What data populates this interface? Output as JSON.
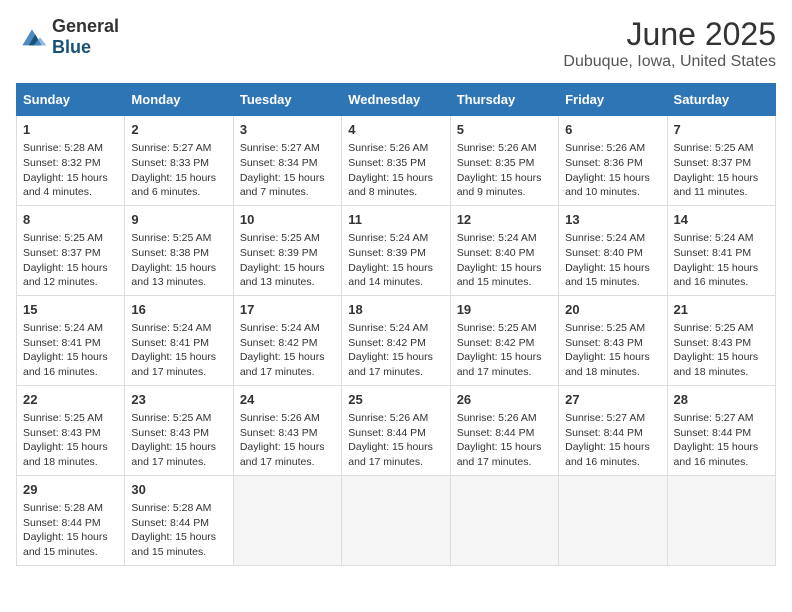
{
  "logo": {
    "general": "General",
    "blue": "Blue"
  },
  "header": {
    "month": "June 2025",
    "location": "Dubuque, Iowa, United States"
  },
  "weekdays": [
    "Sunday",
    "Monday",
    "Tuesday",
    "Wednesday",
    "Thursday",
    "Friday",
    "Saturday"
  ],
  "weeks": [
    [
      {
        "day": "1",
        "sunrise": "5:28 AM",
        "sunset": "8:32 PM",
        "daylight": "15 hours and 4 minutes."
      },
      {
        "day": "2",
        "sunrise": "5:27 AM",
        "sunset": "8:33 PM",
        "daylight": "15 hours and 6 minutes."
      },
      {
        "day": "3",
        "sunrise": "5:27 AM",
        "sunset": "8:34 PM",
        "daylight": "15 hours and 7 minutes."
      },
      {
        "day": "4",
        "sunrise": "5:26 AM",
        "sunset": "8:35 PM",
        "daylight": "15 hours and 8 minutes."
      },
      {
        "day": "5",
        "sunrise": "5:26 AM",
        "sunset": "8:35 PM",
        "daylight": "15 hours and 9 minutes."
      },
      {
        "day": "6",
        "sunrise": "5:26 AM",
        "sunset": "8:36 PM",
        "daylight": "15 hours and 10 minutes."
      },
      {
        "day": "7",
        "sunrise": "5:25 AM",
        "sunset": "8:37 PM",
        "daylight": "15 hours and 11 minutes."
      }
    ],
    [
      {
        "day": "8",
        "sunrise": "5:25 AM",
        "sunset": "8:37 PM",
        "daylight": "15 hours and 12 minutes."
      },
      {
        "day": "9",
        "sunrise": "5:25 AM",
        "sunset": "8:38 PM",
        "daylight": "15 hours and 13 minutes."
      },
      {
        "day": "10",
        "sunrise": "5:25 AM",
        "sunset": "8:39 PM",
        "daylight": "15 hours and 13 minutes."
      },
      {
        "day": "11",
        "sunrise": "5:24 AM",
        "sunset": "8:39 PM",
        "daylight": "15 hours and 14 minutes."
      },
      {
        "day": "12",
        "sunrise": "5:24 AM",
        "sunset": "8:40 PM",
        "daylight": "15 hours and 15 minutes."
      },
      {
        "day": "13",
        "sunrise": "5:24 AM",
        "sunset": "8:40 PM",
        "daylight": "15 hours and 15 minutes."
      },
      {
        "day": "14",
        "sunrise": "5:24 AM",
        "sunset": "8:41 PM",
        "daylight": "15 hours and 16 minutes."
      }
    ],
    [
      {
        "day": "15",
        "sunrise": "5:24 AM",
        "sunset": "8:41 PM",
        "daylight": "15 hours and 16 minutes."
      },
      {
        "day": "16",
        "sunrise": "5:24 AM",
        "sunset": "8:41 PM",
        "daylight": "15 hours and 17 minutes."
      },
      {
        "day": "17",
        "sunrise": "5:24 AM",
        "sunset": "8:42 PM",
        "daylight": "15 hours and 17 minutes."
      },
      {
        "day": "18",
        "sunrise": "5:24 AM",
        "sunset": "8:42 PM",
        "daylight": "15 hours and 17 minutes."
      },
      {
        "day": "19",
        "sunrise": "5:25 AM",
        "sunset": "8:42 PM",
        "daylight": "15 hours and 17 minutes."
      },
      {
        "day": "20",
        "sunrise": "5:25 AM",
        "sunset": "8:43 PM",
        "daylight": "15 hours and 18 minutes."
      },
      {
        "day": "21",
        "sunrise": "5:25 AM",
        "sunset": "8:43 PM",
        "daylight": "15 hours and 18 minutes."
      }
    ],
    [
      {
        "day": "22",
        "sunrise": "5:25 AM",
        "sunset": "8:43 PM",
        "daylight": "15 hours and 18 minutes."
      },
      {
        "day": "23",
        "sunrise": "5:25 AM",
        "sunset": "8:43 PM",
        "daylight": "15 hours and 17 minutes."
      },
      {
        "day": "24",
        "sunrise": "5:26 AM",
        "sunset": "8:43 PM",
        "daylight": "15 hours and 17 minutes."
      },
      {
        "day": "25",
        "sunrise": "5:26 AM",
        "sunset": "8:44 PM",
        "daylight": "15 hours and 17 minutes."
      },
      {
        "day": "26",
        "sunrise": "5:26 AM",
        "sunset": "8:44 PM",
        "daylight": "15 hours and 17 minutes."
      },
      {
        "day": "27",
        "sunrise": "5:27 AM",
        "sunset": "8:44 PM",
        "daylight": "15 hours and 16 minutes."
      },
      {
        "day": "28",
        "sunrise": "5:27 AM",
        "sunset": "8:44 PM",
        "daylight": "15 hours and 16 minutes."
      }
    ],
    [
      {
        "day": "29",
        "sunrise": "5:28 AM",
        "sunset": "8:44 PM",
        "daylight": "15 hours and 15 minutes."
      },
      {
        "day": "30",
        "sunrise": "5:28 AM",
        "sunset": "8:44 PM",
        "daylight": "15 hours and 15 minutes."
      },
      null,
      null,
      null,
      null,
      null
    ]
  ]
}
